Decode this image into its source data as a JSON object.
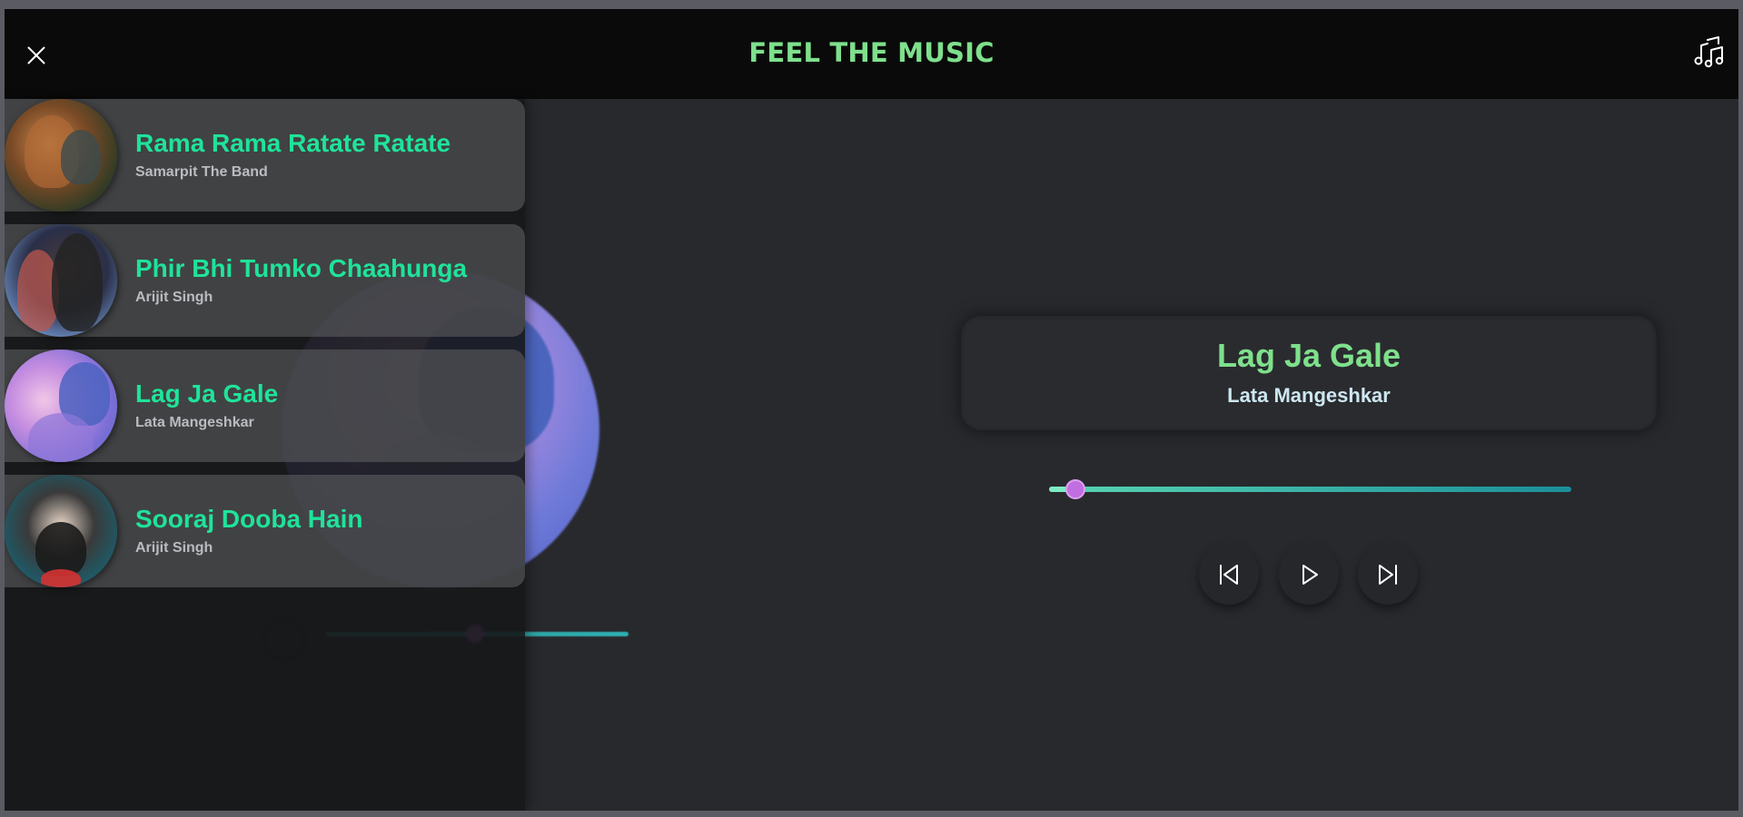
{
  "header": {
    "title": "FEEL THE MUSIC",
    "close_icon": "close-icon",
    "menu_icon": "music-playlist-icon"
  },
  "playlist": [
    {
      "title": "Rama Rama Ratate Ratate",
      "artist": "Samarpit The Band"
    },
    {
      "title": "Phir Bhi Tumko Chaahunga",
      "artist": "Arijit Singh"
    },
    {
      "title": "Lag Ja Gale",
      "artist": "Lata Mangeshkar"
    },
    {
      "title": "Sooraj Dooba Hain",
      "artist": "Arijit Singh"
    }
  ],
  "now_playing": {
    "title": "Lag Ja Gale",
    "artist": "Lata Mangeshkar",
    "progress": 0.05
  },
  "controls": {
    "prev_icon": "skip-previous-icon",
    "play_icon": "play-icon",
    "next_icon": "skip-next-icon"
  },
  "colors": {
    "accent_green": "#7ee08c",
    "song_title_green": "#1fe39a",
    "thumb_purple": "#c16ee0"
  }
}
